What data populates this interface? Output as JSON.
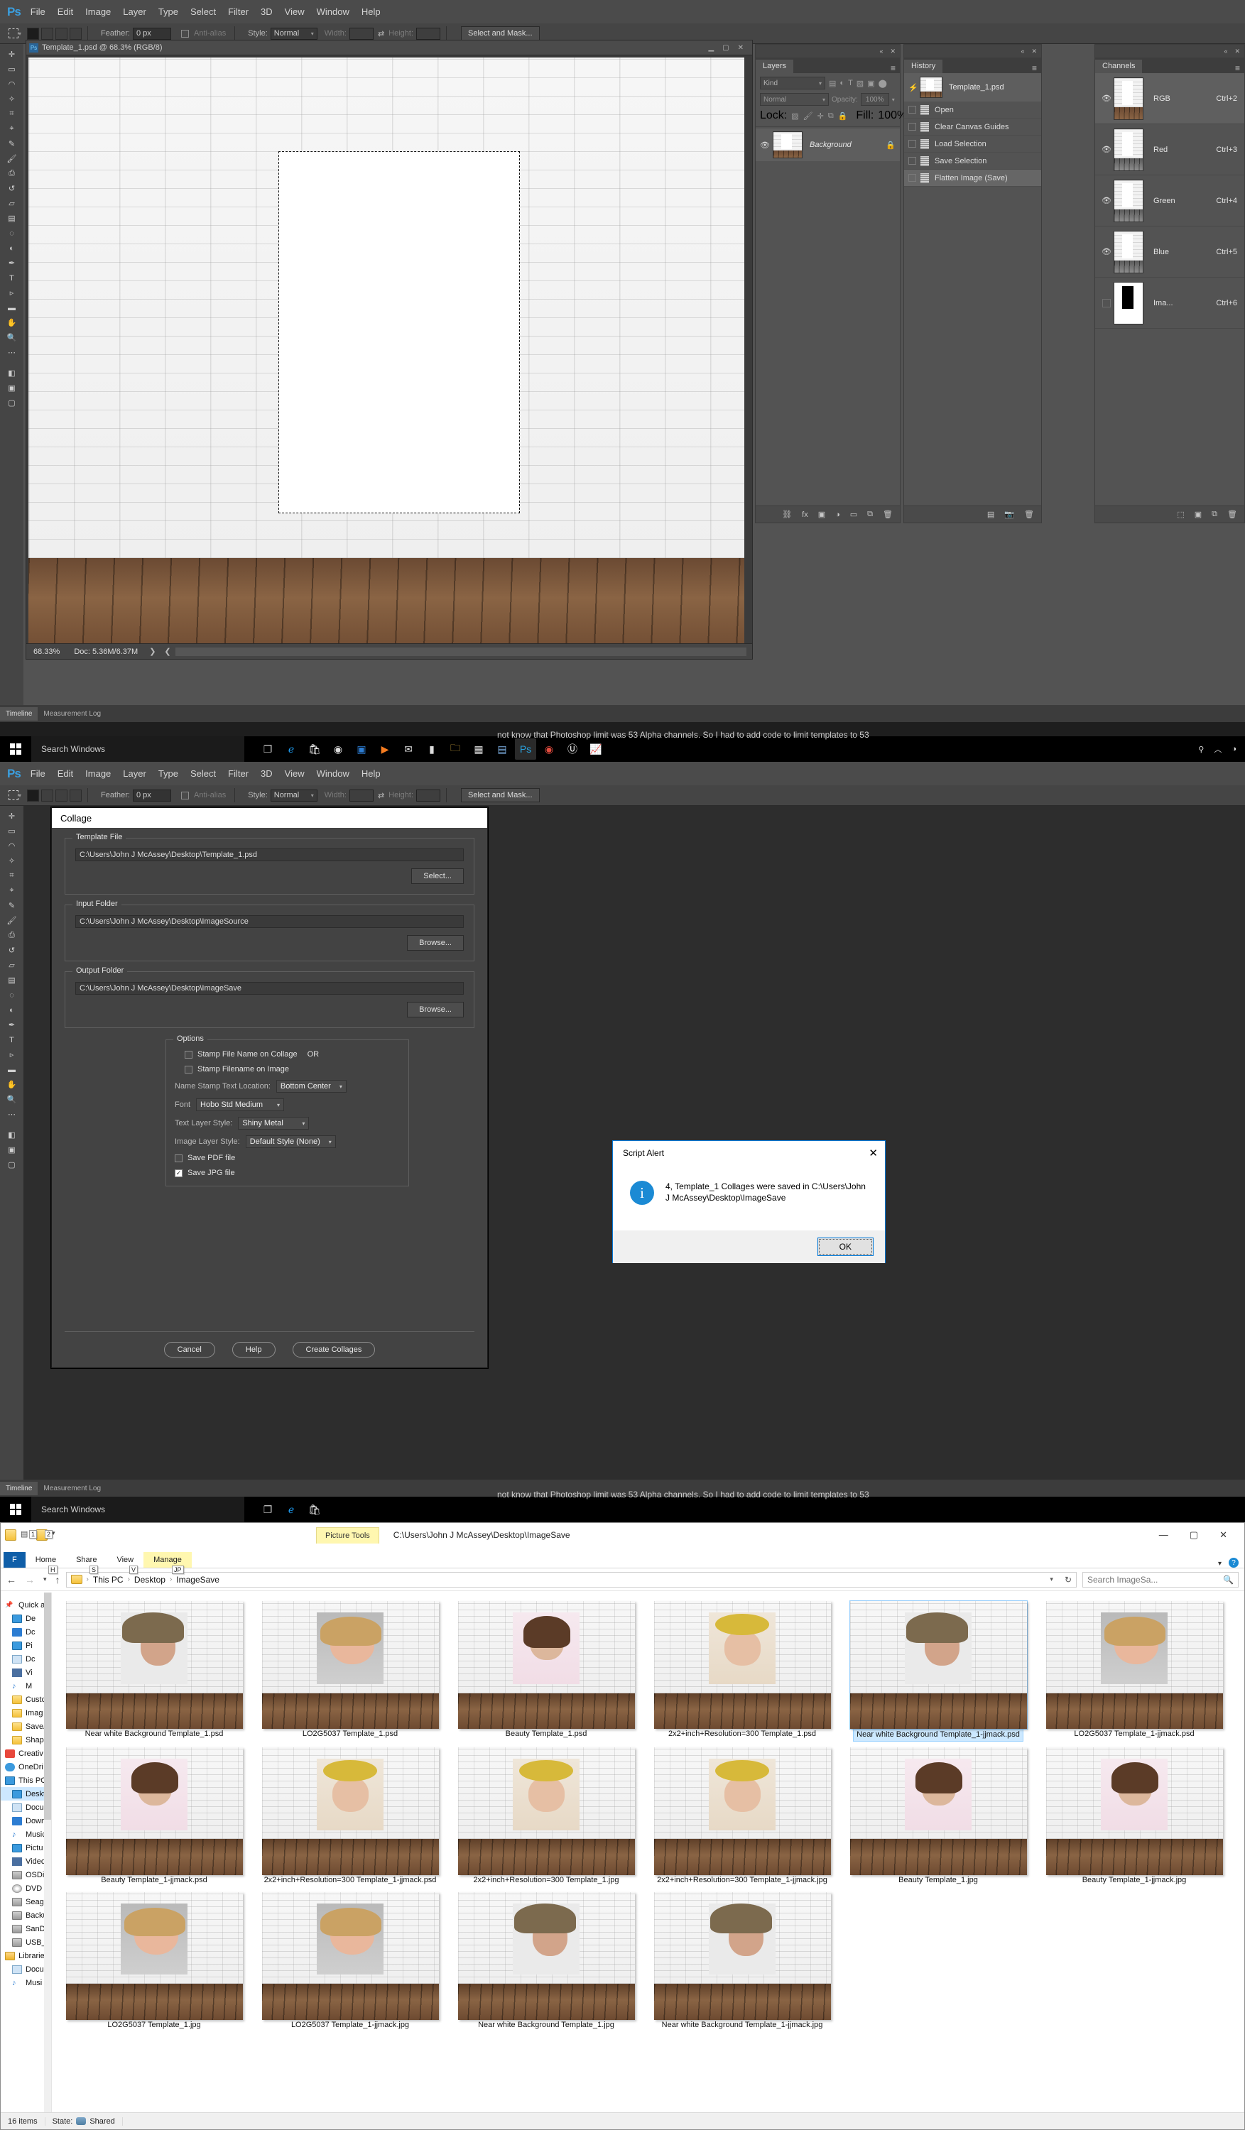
{
  "photoshop": {
    "menu": [
      "File",
      "Edit",
      "Image",
      "Layer",
      "Type",
      "Select",
      "Filter",
      "3D",
      "View",
      "Window",
      "Help"
    ],
    "logo": "Ps",
    "options_bar": {
      "feather_label": "Feather:",
      "feather_value": "0 px",
      "antialias_label": "Anti-alias",
      "style_label": "Style:",
      "style_value": "Normal",
      "width_label": "Width:",
      "width_value": "",
      "height_label": "Height:",
      "height_value": "",
      "select_and_mask": "Select and Mask..."
    },
    "document": {
      "title": "Template_1.psd @ 68.3% (RGB/8)",
      "zoom": "68.33%",
      "doc_size": "Doc: 5.36M/6.37M"
    },
    "layers_panel": {
      "tab": "Layers",
      "filter_kind": "Kind",
      "blend_mode": "Normal",
      "opacity_label": "Opacity:",
      "opacity_value": "100%",
      "lock_label": "Lock:",
      "fill_label": "Fill:",
      "fill_value": "100%",
      "layers": [
        {
          "name": "Background",
          "locked": true,
          "visible": true
        }
      ]
    },
    "history_panel": {
      "tab": "History",
      "source": "Template_1.psd",
      "states": [
        {
          "label": "Open",
          "selected": false
        },
        {
          "label": "Clear Canvas Guides",
          "selected": false
        },
        {
          "label": "Load Selection",
          "selected": false
        },
        {
          "label": "Save Selection",
          "selected": false
        },
        {
          "label": "Flatten Image (Save)",
          "selected": true
        }
      ]
    },
    "channels_panel": {
      "tab": "Channels",
      "channels": [
        {
          "name": "RGB",
          "shortcut": "Ctrl+2",
          "visible": true,
          "type": "color",
          "selected": true
        },
        {
          "name": "Red",
          "shortcut": "Ctrl+3",
          "visible": true,
          "type": "gray",
          "selected": false
        },
        {
          "name": "Green",
          "shortcut": "Ctrl+4",
          "visible": true,
          "type": "gray",
          "selected": false
        },
        {
          "name": "Blue",
          "shortcut": "Ctrl+5",
          "visible": true,
          "type": "gray",
          "selected": false
        },
        {
          "name": "Ima...",
          "shortcut": "Ctrl+6",
          "visible": false,
          "type": "alpha",
          "selected": false
        }
      ]
    },
    "timeline": {
      "tab1": "Timeline",
      "tab2": "Measurement Log"
    }
  },
  "taskbar": {
    "search_placeholder": "Search Windows",
    "background_text": "not know that Photoshop limit was 53 Alpha channels.  So I had to add code to limit templates to 53"
  },
  "collage_dialog": {
    "title": "Collage",
    "template_group": {
      "legend": "Template File",
      "path": "C:\\Users\\John J McAssey\\Desktop\\Template_1.psd",
      "button": "Select..."
    },
    "input_group": {
      "legend": "Input Folder",
      "path": "C:\\Users\\John J McAssey\\Desktop\\ImageSource",
      "button": "Browse..."
    },
    "output_group": {
      "legend": "Output Folder",
      "path": "C:\\Users\\John J McAssey\\Desktop\\ImageSave",
      "button": "Browse..."
    },
    "options": {
      "legend": "Options",
      "stamp_file_name_on_collage": {
        "label": "Stamp File Name on Collage",
        "checked": false,
        "suffix": "OR"
      },
      "stamp_filename_on_image": {
        "label": "Stamp Filename on Image",
        "checked": false
      },
      "name_stamp_location": {
        "label": "Name Stamp Text  Location:",
        "value": "Bottom Center"
      },
      "font": {
        "label": "Font",
        "value": "Hobo Std Medium"
      },
      "text_layer_style": {
        "label": "Text Layer Style:",
        "value": "Shiny Metal"
      },
      "image_layer_style": {
        "label": "Image Layer Style:",
        "value": "Default Style (None)"
      },
      "save_pdf": {
        "label": "Save PDF file",
        "checked": false
      },
      "save_jpg": {
        "label": "Save JPG file",
        "checked": true
      }
    },
    "buttons": {
      "cancel": "Cancel",
      "help": "Help",
      "create": "Create Collages"
    }
  },
  "script_alert": {
    "title": "Script Alert",
    "close": "✕",
    "message": "4, Template_1 Collages were saved in C:\\Users\\John J McAssey\\Desktop\\ImageSave",
    "ok": "OK",
    "icon": "i"
  },
  "explorer": {
    "picture_tools": "Picture Tools",
    "title_path": "C:\\Users\\John J McAssey\\Desktop\\ImageSave",
    "file_tab": "F",
    "tabs": [
      {
        "label": "Home",
        "keytip": "H"
      },
      {
        "label": "Share",
        "keytip": "S"
      },
      {
        "label": "View",
        "keytip": "V"
      },
      {
        "label": "Manage",
        "keytip": "JP"
      }
    ],
    "qat_keytips": [
      "1",
      "2"
    ],
    "breadcrumb": [
      "This PC",
      "Desktop",
      "ImageSave"
    ],
    "search_placeholder": "Search ImageSa...",
    "window_buttons": [
      "—",
      "▢",
      "✕"
    ],
    "sidebar": [
      {
        "label": "Quick a",
        "icon": "pin",
        "indent": false
      },
      {
        "label": "De",
        "icon": "screen",
        "indent": true,
        "pinned": true
      },
      {
        "label": "Dc",
        "icon": "blue",
        "indent": true,
        "pinned": true
      },
      {
        "label": "Pi",
        "icon": "screen",
        "indent": true,
        "pinned": true
      },
      {
        "label": "Dc",
        "icon": "doc",
        "indent": true,
        "pinned": true
      },
      {
        "label": "Vi",
        "icon": "video",
        "indent": true,
        "pinned": true
      },
      {
        "label": "M",
        "icon": "music",
        "indent": true,
        "pinned": true
      },
      {
        "label": "Custo",
        "icon": "folder",
        "indent": true
      },
      {
        "label": "Imag",
        "icon": "folder",
        "indent": true
      },
      {
        "label": "SaveA",
        "icon": "folder",
        "indent": true
      },
      {
        "label": "Shap",
        "icon": "folder",
        "indent": true
      },
      {
        "label": "Creativ",
        "icon": "cc",
        "indent": false
      },
      {
        "label": "OneDri",
        "icon": "cloud",
        "indent": false
      },
      {
        "label": "This PC",
        "icon": "screen",
        "indent": false
      },
      {
        "label": "Deskt",
        "icon": "screen",
        "indent": true,
        "selected": true
      },
      {
        "label": "Docu",
        "icon": "doc",
        "indent": true
      },
      {
        "label": "Down",
        "icon": "blue",
        "indent": true
      },
      {
        "label": "Music",
        "icon": "music",
        "indent": true
      },
      {
        "label": "Pictu",
        "icon": "screen",
        "indent": true
      },
      {
        "label": "Video",
        "icon": "video",
        "indent": true
      },
      {
        "label": "OSDis",
        "icon": "disk",
        "indent": true
      },
      {
        "label": "DVD",
        "icon": "cd",
        "indent": true
      },
      {
        "label": "Seaga",
        "icon": "disk",
        "indent": true
      },
      {
        "label": "Backu",
        "icon": "disk",
        "indent": true
      },
      {
        "label": "SanD",
        "icon": "disk",
        "indent": true
      },
      {
        "label": "USB_S",
        "icon": "disk",
        "indent": true
      },
      {
        "label": "Librarie",
        "icon": "lib",
        "indent": false
      },
      {
        "label": "Docu",
        "icon": "doc",
        "indent": true
      },
      {
        "label": "Musi",
        "icon": "music",
        "indent": true
      }
    ],
    "files": [
      {
        "name": "Near white Background Template_1.psd",
        "face": "f-wind",
        "selected": false
      },
      {
        "name": "LO2G5037 Template_1.psd",
        "face": "f-child",
        "selected": false
      },
      {
        "name": "Beauty Template_1.psd",
        "face": "f-beauty",
        "selected": false
      },
      {
        "name": "2x2+inch+Resolution=300 Template_1.psd",
        "face": "f-flower",
        "selected": false
      },
      {
        "name": "Near white Background Template_1-jjmack.psd",
        "face": "f-wind",
        "selected": true
      },
      {
        "name": "LO2G5037 Template_1-jjmack.psd",
        "face": "f-child",
        "selected": false
      },
      {
        "name": "Beauty Template_1-jjmack.psd",
        "face": "f-beauty",
        "selected": false
      },
      {
        "name": "2x2+inch+Resolution=300 Template_1-jjmack.psd",
        "face": "f-flower",
        "selected": false
      },
      {
        "name": "2x2+inch+Resolution=300 Template_1.jpg",
        "face": "f-flower",
        "selected": false
      },
      {
        "name": "2x2+inch+Resolution=300 Template_1-jjmack.jpg",
        "face": "f-flower",
        "selected": false
      },
      {
        "name": "Beauty Template_1.jpg",
        "face": "f-beauty",
        "selected": false
      },
      {
        "name": "Beauty Template_1-jjmack.jpg",
        "face": "f-beauty",
        "selected": false
      },
      {
        "name": "LO2G5037 Template_1.jpg",
        "face": "f-child",
        "selected": false
      },
      {
        "name": "LO2G5037 Template_1-jjmack.jpg",
        "face": "f-child",
        "selected": false
      },
      {
        "name": "Near white Background Template_1.jpg",
        "face": "f-wind",
        "selected": false
      },
      {
        "name": "Near white Background Template_1-jjmack.jpg",
        "face": "f-wind",
        "selected": false
      }
    ],
    "status": {
      "items": "16 items",
      "state_label": "State:",
      "state_value": "Shared"
    }
  }
}
